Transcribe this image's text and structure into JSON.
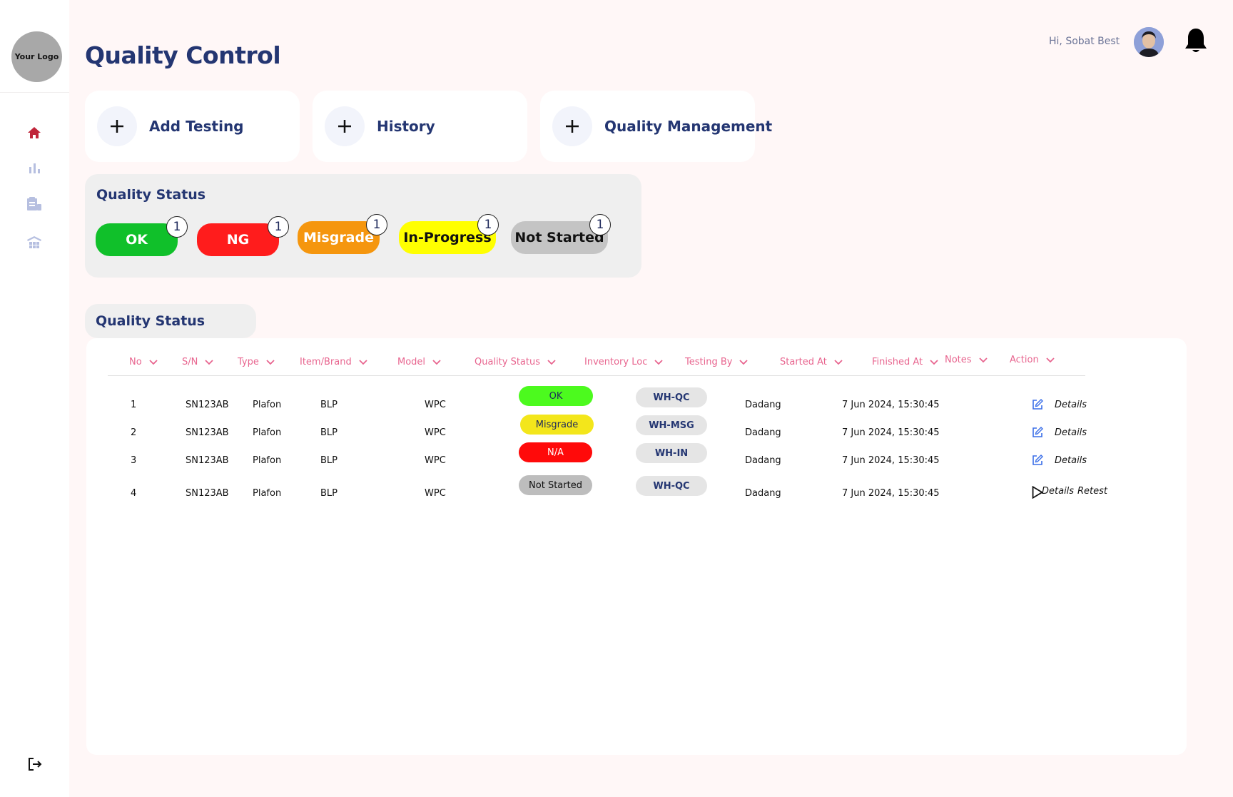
{
  "sidebar": {
    "logo_text": "Your Logo",
    "items": [
      {
        "icon": "home-icon",
        "active": true
      },
      {
        "icon": "bar-chart-icon",
        "active": false
      },
      {
        "icon": "report-icon",
        "active": false
      },
      {
        "icon": "warehouse-icon",
        "active": false
      }
    ],
    "logout_icon": "logout-icon"
  },
  "header": {
    "title": "Quality Control",
    "greeting": "Hi, Sobat Best"
  },
  "actions": [
    {
      "label": "Add Testing"
    },
    {
      "label": "History"
    },
    {
      "label": "Quality Management"
    }
  ],
  "status_panel": {
    "title": "Quality Status",
    "pills": [
      {
        "label": "OK",
        "count": "1",
        "color": "#10c02a",
        "text_color": "#ffffff"
      },
      {
        "label": "NG",
        "count": "1",
        "color": "#ff1c1c",
        "text_color": "#ffffff"
      },
      {
        "label": "Misgrade",
        "count": "1",
        "color": "#f5960e",
        "text_color": "#ffffff"
      },
      {
        "label": "In-Progress",
        "count": "1",
        "color": "#ffff00",
        "text_color": "#111111"
      },
      {
        "label": "Not Started",
        "count": "1",
        "color": "#c4c4c4",
        "text_color": "#111111"
      }
    ]
  },
  "table": {
    "tab_label": "Quality Status",
    "columns": [
      "No",
      "S/N",
      "Type",
      "Item/Brand",
      "Model",
      "Quality Status",
      "Inventory Loc",
      "Testing By",
      "Started At",
      "Finished At",
      "Notes",
      "Action"
    ],
    "rows": [
      {
        "no": "1",
        "sn": "SN123AB",
        "type": "Plafon",
        "brand": "BLP",
        "model": "WPC",
        "status": "OK",
        "status_color": "#4cfa1e",
        "status_text": "#1f2a5c",
        "loc": "WH-QC",
        "tester": "Dadang",
        "started": "7 Jun 2024, 15:30:45",
        "finished": "",
        "notes": "",
        "action": "Details",
        "action2": ""
      },
      {
        "no": "2",
        "sn": "SN123AB",
        "type": "Plafon",
        "brand": "BLP",
        "model": "WPC",
        "status": "Misgrade",
        "status_color": "#f3e61b",
        "status_text": "#1f2a5c",
        "loc": "WH-MSG",
        "tester": "Dadang",
        "started": "7 Jun 2024, 15:30:45",
        "finished": "",
        "notes": "",
        "action": "Details",
        "action2": ""
      },
      {
        "no": "3",
        "sn": "SN123AB",
        "type": "Plafon",
        "brand": "BLP",
        "model": "WPC",
        "status": "N/A",
        "status_color": "#ff0a0a",
        "status_text": "#ffffff",
        "loc": "WH-IN",
        "tester": "Dadang",
        "started": "7 Jun 2024, 15:30:45",
        "finished": "",
        "notes": "",
        "action": "Details",
        "action2": ""
      },
      {
        "no": "4",
        "sn": "SN123AB",
        "type": "Plafon",
        "brand": "BLP",
        "model": "WPC",
        "status": "Not Started",
        "status_color": "#bdbdbd",
        "status_text": "#111111",
        "loc": "WH-QC",
        "tester": "Dadang",
        "started": "7 Jun 2024, 15:30:45",
        "finished": "",
        "notes": "",
        "action": "Details",
        "action2": "Retest"
      }
    ]
  }
}
